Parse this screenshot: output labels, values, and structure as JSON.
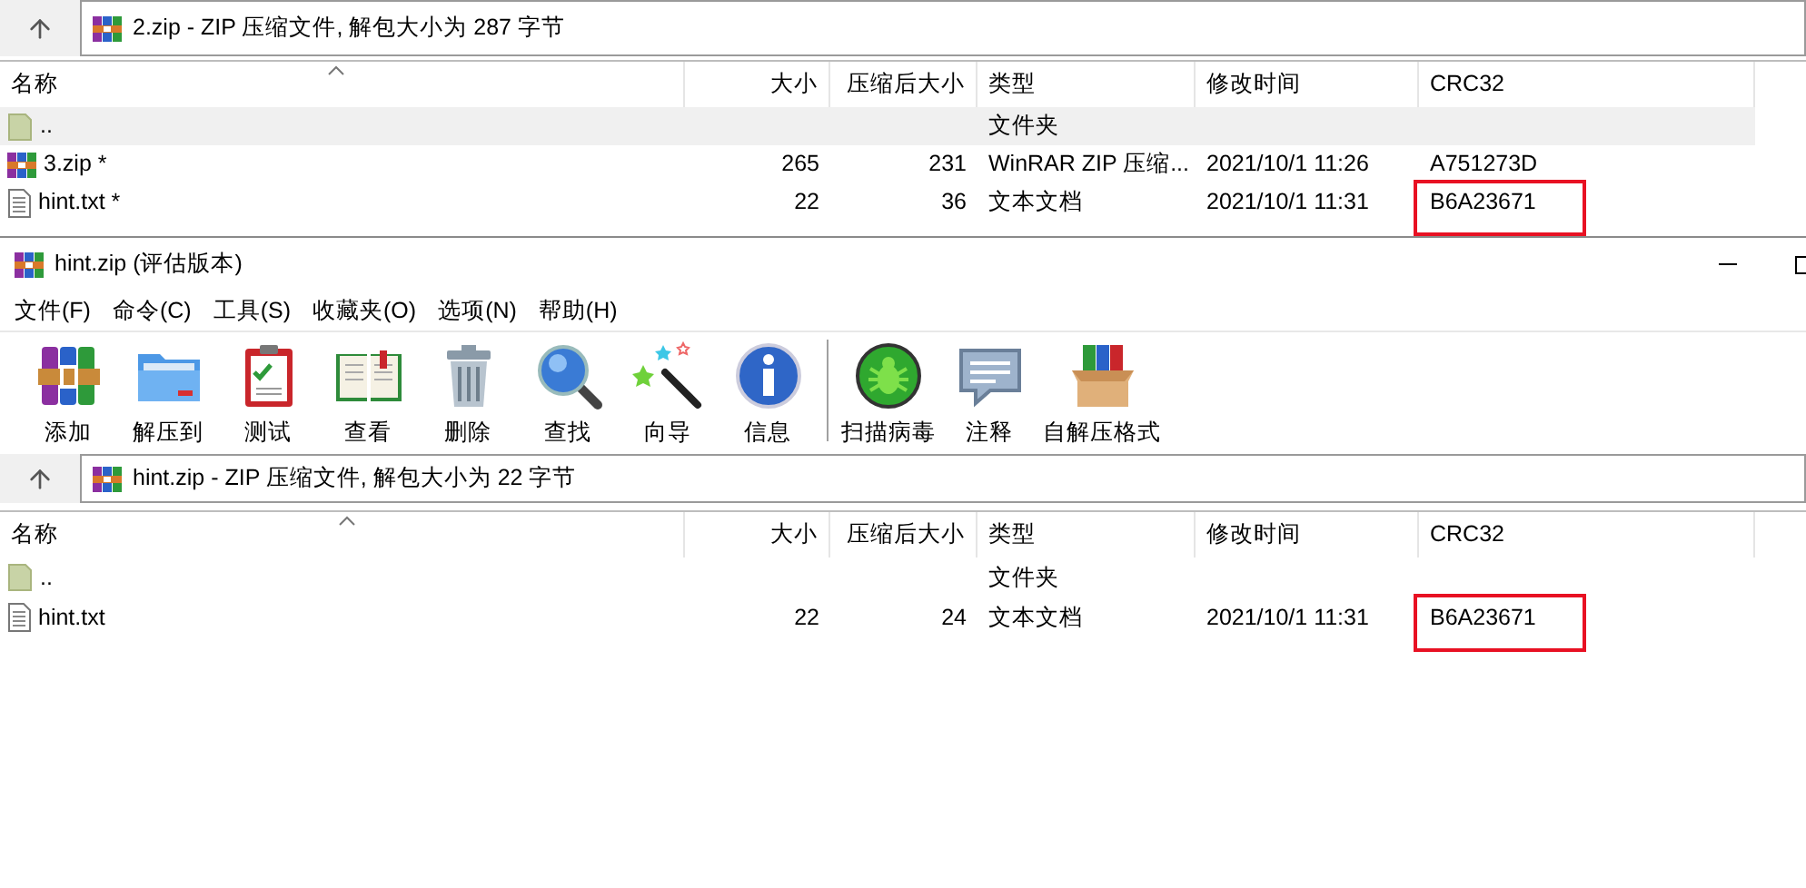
{
  "window_behind": {
    "path_bar": {
      "text": "2.zip - ZIP 压缩文件, 解包大小为 287 字节"
    },
    "table": {
      "columns": [
        "名称",
        "大小",
        "压缩后大小",
        "类型",
        "修改时间",
        "CRC32"
      ],
      "rows": [
        {
          "kind": "parent",
          "name": "..",
          "type": "文件夹",
          "selected": true,
          "crc_highlighted": false
        },
        {
          "kind": "archive",
          "name": "3.zip *",
          "size": "265",
          "packed": "231",
          "type": "WinRAR ZIP 压缩...",
          "modified": "2021/10/1 11:26",
          "crc": "A751273D",
          "selected": false,
          "crc_highlighted": false
        },
        {
          "kind": "text",
          "name": "hint.txt *",
          "size": "22",
          "packed": "36",
          "type": "文本文档",
          "modified": "2021/10/1 11:31",
          "crc": "B6A23671",
          "selected": false,
          "crc_highlighted": true
        }
      ]
    }
  },
  "window": {
    "title": "hint.zip (评估版本)",
    "menu": [
      "文件(F)",
      "命令(C)",
      "工具(S)",
      "收藏夹(O)",
      "选项(N)",
      "帮助(H)"
    ],
    "toolbar": [
      {
        "kind": "add",
        "label": "添加"
      },
      {
        "kind": "extract",
        "label": "解压到"
      },
      {
        "kind": "test",
        "label": "测试"
      },
      {
        "kind": "view",
        "label": "查看"
      },
      {
        "kind": "delete",
        "label": "删除"
      },
      {
        "kind": "find",
        "label": "查找"
      },
      {
        "kind": "wizard",
        "label": "向导"
      },
      {
        "kind": "info",
        "label": "信息"
      },
      {
        "kind": "separator"
      },
      {
        "kind": "virus",
        "label": "扫描病毒"
      },
      {
        "kind": "comment",
        "label": "注释"
      },
      {
        "kind": "sfx",
        "label": "自解压格式"
      }
    ],
    "path_bar": {
      "text": "hint.zip - ZIP 压缩文件, 解包大小为 22 字节"
    },
    "table": {
      "columns": [
        "名称",
        "大小",
        "压缩后大小",
        "类型",
        "修改时间",
        "CRC32"
      ],
      "rows": [
        {
          "kind": "parent",
          "name": "..",
          "type": "文件夹",
          "selected": false,
          "crc_highlighted": false
        },
        {
          "kind": "text",
          "name": "hint.txt",
          "size": "22",
          "packed": "24",
          "type": "文本文档",
          "modified": "2021/10/1 11:31",
          "crc": "B6A23671",
          "selected": false,
          "crc_highlighted": true
        }
      ]
    }
  }
}
